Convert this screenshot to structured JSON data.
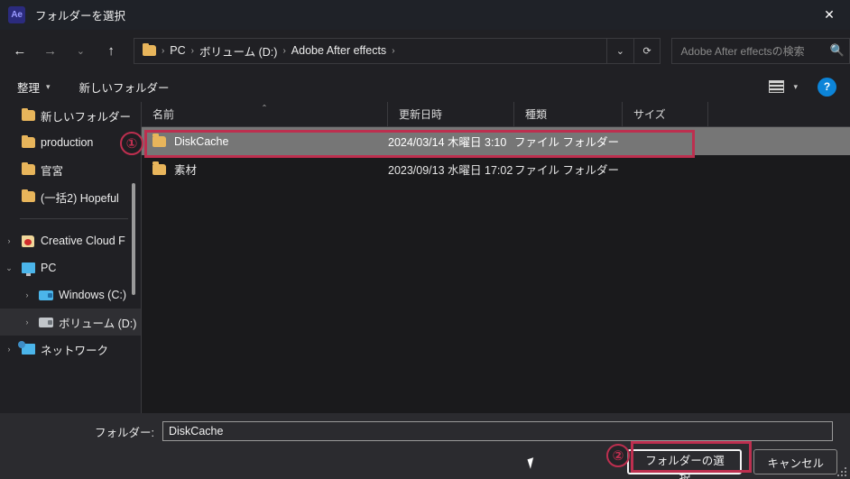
{
  "window": {
    "app_icon_label": "Ae",
    "title": "フォルダーを選択",
    "close_label": "✕"
  },
  "nav": {
    "back": "←",
    "forward": "→",
    "recent": "⌄",
    "up": "↑",
    "breadcrumb": [
      {
        "label": "PC"
      },
      {
        "label": "ボリューム (D:)"
      },
      {
        "label": "Adobe After effects"
      }
    ],
    "separator": "›",
    "dropdown": "⌄",
    "refresh": "⟳"
  },
  "search": {
    "placeholder": "Adobe After effectsの検索",
    "icon": "search-icon"
  },
  "toolbar": {
    "organize": "整理",
    "organize_caret": "▾",
    "new_folder": "新しいフォルダー",
    "view_caret": "▾",
    "help": "?"
  },
  "sidebar": {
    "quick_items": [
      {
        "label": "新しいフォルダー",
        "icon": "folder-icon"
      },
      {
        "label": "production",
        "icon": "folder-icon"
      },
      {
        "label": "官宮",
        "icon": "folder-icon"
      },
      {
        "label": "(一括2) Hopeful",
        "icon": "folder-icon"
      }
    ],
    "tree_items": [
      {
        "label": "Creative Cloud F",
        "icon": "creative-cloud-icon",
        "chevron": "›",
        "expanded": false,
        "indent": 0,
        "selected": false
      },
      {
        "label": "PC",
        "icon": "pc-icon",
        "chevron": "⌄",
        "expanded": true,
        "indent": 0,
        "selected": false
      },
      {
        "label": "Windows (C:)",
        "icon": "drive-icon",
        "chevron": "›",
        "expanded": false,
        "indent": 1,
        "selected": false
      },
      {
        "label": "ボリューム (D:)",
        "icon": "drive-icon",
        "chevron": "›",
        "expanded": false,
        "indent": 1,
        "selected": true
      },
      {
        "label": "ネットワーク",
        "icon": "network-icon",
        "chevron": "›",
        "expanded": false,
        "indent": 0,
        "selected": false
      }
    ]
  },
  "filelist": {
    "columns": [
      {
        "label": "名前",
        "sorted": "asc",
        "sort_caret": "⌃"
      },
      {
        "label": "更新日時"
      },
      {
        "label": "種類"
      },
      {
        "label": "サイズ"
      }
    ],
    "rows": [
      {
        "name": "DiskCache",
        "date": "2024/03/14 木曜日 3:10",
        "type": "ファイル フォルダー",
        "size": "",
        "selected": true
      },
      {
        "name": "素材",
        "date": "2023/09/13 水曜日 17:02",
        "type": "ファイル フォルダー",
        "size": "",
        "selected": false
      }
    ]
  },
  "bottom": {
    "folder_label": "フォルダー:",
    "folder_value": "DiskCache",
    "select_button": "フォルダーの選択",
    "cancel_button": "キャンセル"
  },
  "annotations": {
    "marker_one": "①",
    "marker_two": "②",
    "color": "#bd2f4f"
  }
}
